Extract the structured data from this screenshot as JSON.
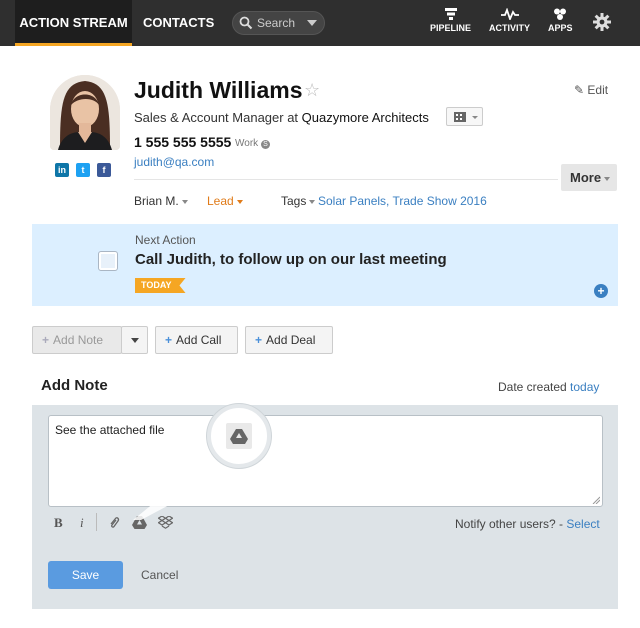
{
  "nav": {
    "tabs": [
      "ACTION STREAM",
      "CONTACTS"
    ],
    "search_placeholder": "Search",
    "icons": [
      {
        "label": "PIPELINE",
        "icon": "pipeline-icon"
      },
      {
        "label": "ACTIVITY",
        "icon": "activity-icon"
      },
      {
        "label": "APPS",
        "icon": "apps-icon"
      }
    ],
    "settings_icon": "gear-icon"
  },
  "contact": {
    "name": "Judith Williams",
    "edit_label": "Edit",
    "title": "Sales & Account Manager at ",
    "company": "Quazymore Architects",
    "phone": "1 555 555 5555",
    "phone_type": "Work",
    "email": "judith@qa.com",
    "more_label": "More",
    "owner": "Brian M.",
    "status": "Lead",
    "tags_label": "Tags",
    "tags": "Solar Panels, Trade Show 2016",
    "social": [
      "in",
      "t",
      "f"
    ]
  },
  "next_action": {
    "label": "Next Action",
    "title": "Call Judith, to follow up on our last meeting",
    "badge": "TODAY"
  },
  "actions": {
    "add_note": "Add Note",
    "add_call": "Add Call",
    "add_deal": "Add Deal"
  },
  "note": {
    "heading": "Add Note",
    "date_label": "Date created ",
    "date_value": "today",
    "text": "See the attached file",
    "notify_label": "Notify other users? - ",
    "notify_link": "Select",
    "save_label": "Save",
    "cancel_label": "Cancel",
    "toolbar": [
      "B",
      "i"
    ]
  },
  "colors": {
    "accent": "#f5a623",
    "link": "#3a7fc1",
    "next_action_bg": "#dcefff",
    "save_button": "#5a9be0",
    "topbar": "#2f2f2f"
  }
}
